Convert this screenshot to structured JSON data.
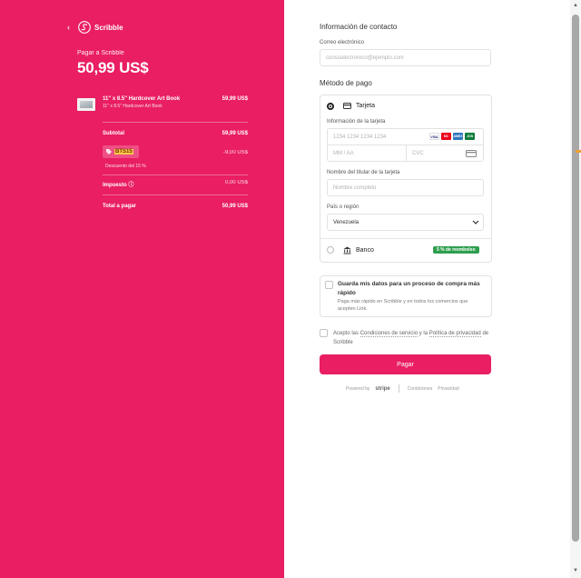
{
  "merchant": {
    "name": "Scribble",
    "back_label": "‹"
  },
  "summary": {
    "pay_to": "Pagar a Scribble",
    "total": "50,99 US$",
    "product": {
      "name": "11\" x 8.5\" Hardcover Art Book",
      "variant": "11\" x 8.5\" Hardcover Art Book",
      "price": "59,99 US$"
    },
    "subtotal_label": "Subtotal",
    "subtotal_value": "59,99 US$",
    "promo_code": "BTS15",
    "promo_amount": "-9,00 US$",
    "discount_note": "Descuento del 15 %",
    "tax_label": "Impuesto ⓘ",
    "tax_value": "0,00 US$",
    "total_label": "Total a pagar",
    "total_value": "50,99 US$"
  },
  "contact": {
    "title": "Información de contacto",
    "email_label": "Correo electrónico",
    "email_placeholder": "consoalectroreco@ejemplo.com"
  },
  "payment": {
    "title": "Método de pago",
    "card_option": "Tarjeta",
    "card_info_label": "Información de la tarjeta",
    "card_number_placeholder": "1234 1234 1234 1234",
    "card_brands": [
      "VISA",
      "MC",
      "AMEX",
      "JCB"
    ],
    "expiry_placeholder": "MM / AA",
    "cvc_placeholder": "CVC",
    "holder_label": "Nombre del titular de la tarjeta",
    "holder_placeholder": "Nombre completo",
    "country_label": "País o región",
    "country_value": "Venezuela",
    "bank_option": "Banco",
    "bank_badge": "5 % de reembolso"
  },
  "save": {
    "title": "Guarda mis datos para un proceso de compra más rápido",
    "desc": "Paga más rápido en Scribble y en todos los comercios que acepten Link."
  },
  "terms": {
    "prefix": "Acepto las ",
    "link1": "Condiciones de servicio",
    "mid": " y la ",
    "link2": "Política de privacidad",
    "suffix": " de Scribble"
  },
  "pay_button": "Pagar",
  "footer": {
    "powered": "Powered by",
    "stripe": "stripe",
    "terms": "Condiciones",
    "privacy": "Privacidad"
  },
  "colors": {
    "brand": "#e91e63",
    "badge": "#2e9e4f"
  }
}
